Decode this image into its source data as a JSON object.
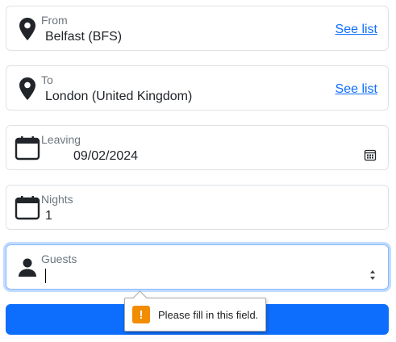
{
  "from": {
    "label": "From",
    "value": "Belfast (BFS)",
    "link": "See list",
    "icon": "location-pin-icon"
  },
  "to": {
    "label": "To",
    "value": "London (United Kingdom)",
    "link": "See list",
    "icon": "location-pin-icon"
  },
  "leaving": {
    "label": "Leaving",
    "value": "09/02/2024",
    "icon": "calendar-icon"
  },
  "nights": {
    "label": "Nights",
    "value": "1",
    "icon": "calendar-icon"
  },
  "guests": {
    "label": "Guests",
    "value": "",
    "icon": "person-icon"
  },
  "validation": {
    "message": "Please fill in this field.",
    "icon_glyph": "!"
  },
  "colors": {
    "primary": "#0d6efd",
    "warning": "#f28c00"
  }
}
